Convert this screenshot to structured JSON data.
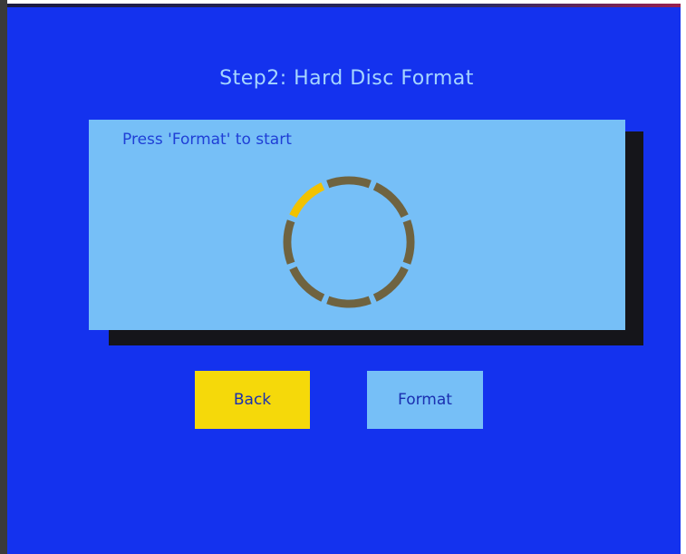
{
  "screen": {
    "title": "Step2: Hard Disc Format",
    "prompt": "Press 'Format' to start"
  },
  "progress": {
    "segments_total": 8,
    "segments_complete": 1,
    "complete_color": "#f2c200",
    "pending_color": "#6f6340"
  },
  "buttons": {
    "back_label": "Back",
    "format_label": "Format",
    "selected": "back"
  },
  "colors": {
    "background": "#1432ee",
    "panel": "#76bff7",
    "title_text": "#a6d6ff",
    "button_selected": "#f5d90a"
  }
}
